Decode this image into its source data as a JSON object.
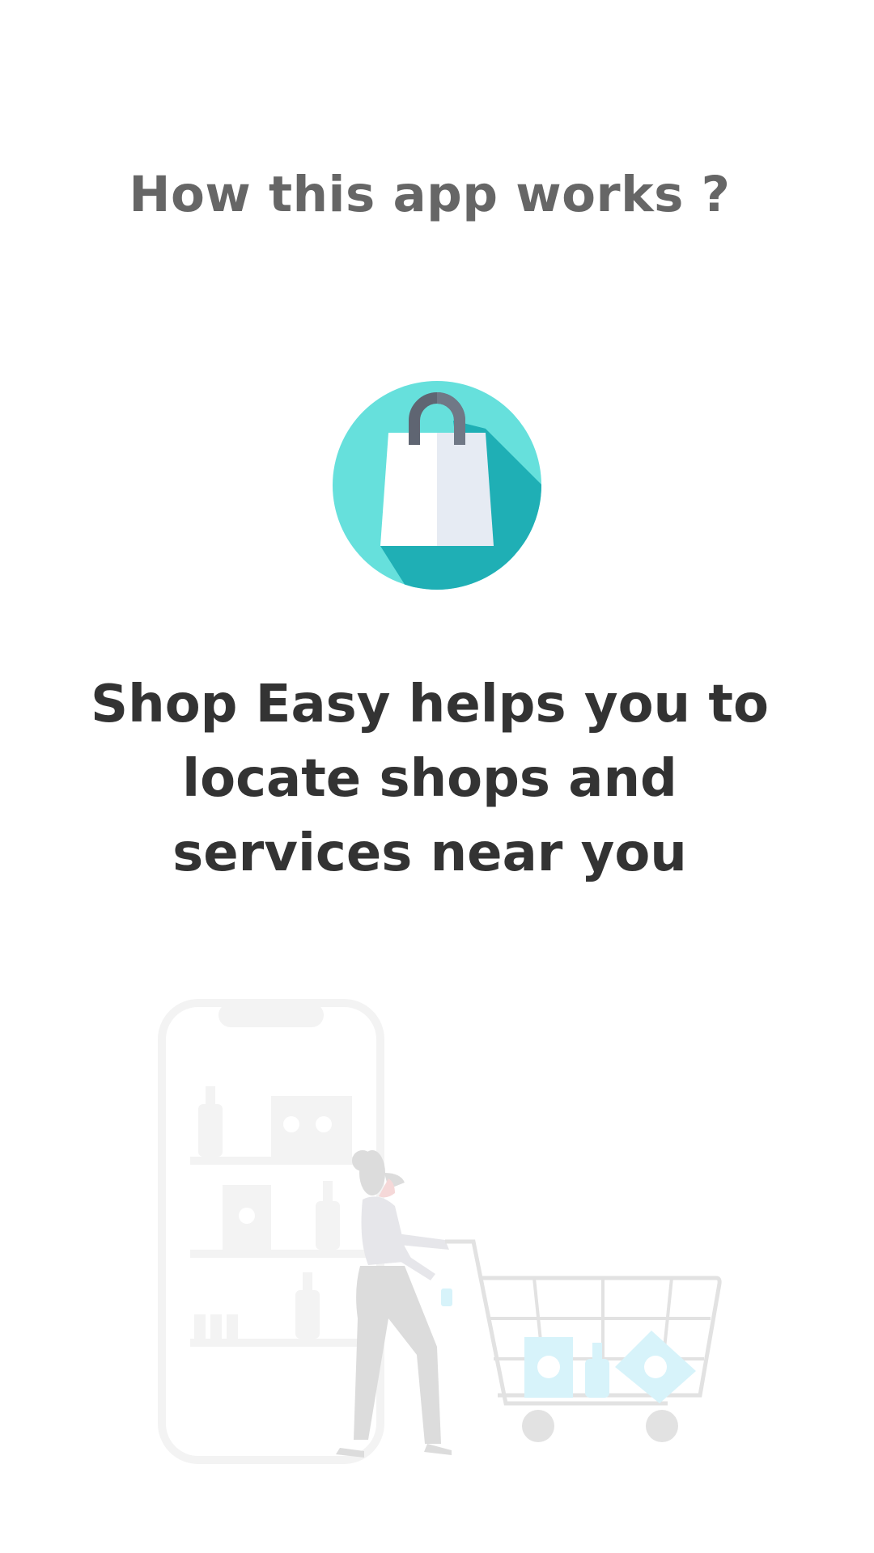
{
  "header": {
    "title": "How this app works ?"
  },
  "logo": {
    "icon": "shopping-bag-icon",
    "colors": {
      "circle": "#66E0DC",
      "shadow": "#1FAFB5",
      "bag_left": "#FFFFFF",
      "bag_right": "#E6EBF3",
      "handle": "#6B7280"
    }
  },
  "main": {
    "tagline": "Shop Easy helps you to locate shops and services near you"
  },
  "illustration": {
    "icon": "shopping-cart-illustration"
  }
}
